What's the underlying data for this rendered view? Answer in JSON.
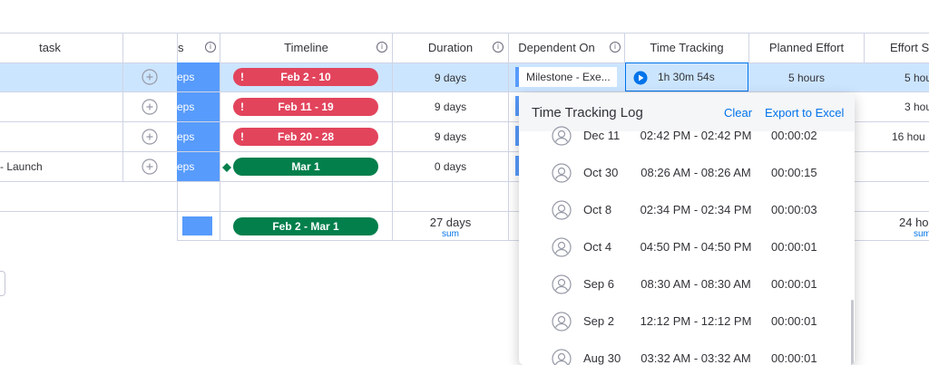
{
  "columns": {
    "task": "task",
    "owners_fragment": "s",
    "timeline": "Timeline",
    "duration": "Duration",
    "dependent_on": "Dependent On",
    "time_tracking": "Time Tracking",
    "planned_effort": "Planned Effort",
    "effort_spent": "Effort S"
  },
  "rows": [
    {
      "task": "",
      "status": "eps",
      "timeline": "Feb 2 - 10",
      "timeline_color": "#e2445c",
      "duration": "9 days",
      "dependent_on": "Milestone - Exe...",
      "time_tracking": "1h 30m 54s",
      "planned_effort": "5 hours",
      "effort_spent": "5 hou"
    },
    {
      "task": "",
      "status": "eps",
      "timeline": "Feb 11 - 19",
      "timeline_color": "#e2445c",
      "duration": "9 days",
      "planned_effort": "",
      "effort_spent": "3 hou"
    },
    {
      "task": "",
      "status": "eps",
      "timeline": "Feb 20 - 28",
      "timeline_color": "#e2445c",
      "duration": "9 days",
      "planned_effort": "",
      "effort_spent": "16 hou"
    },
    {
      "task": "- Launch",
      "status": "eps",
      "timeline": "Mar 1",
      "timeline_color": "#037f4c",
      "duration": "0 days",
      "planned_effort": "",
      "effort_spent": ""
    }
  ],
  "summary": {
    "timeline": "Feb 2 - Mar 1",
    "duration": "27 days",
    "duration_sub": "sum",
    "effort_spent": "24 hou",
    "effort_sub": "sum"
  },
  "popup": {
    "title": "Time Tracking Log",
    "clear": "Clear",
    "export": "Export to Excel",
    "entries": [
      {
        "date": "Dec 11",
        "range": "02:42 PM - 02:42 PM",
        "duration": "00:00:02"
      },
      {
        "date": "Oct 30",
        "range": "08:26 AM - 08:26 AM",
        "duration": "00:00:15"
      },
      {
        "date": "Oct 8",
        "range": "02:34 PM - 02:34 PM",
        "duration": "00:00:03"
      },
      {
        "date": "Oct 4",
        "range": "04:50 PM - 04:50 PM",
        "duration": "00:00:01"
      },
      {
        "date": "Sep 6",
        "range": "08:30 AM - 08:30 AM",
        "duration": "00:00:01"
      },
      {
        "date": "Sep 2",
        "range": "12:12 PM - 12:12 PM",
        "duration": "00:00:01"
      },
      {
        "date": "Aug 30",
        "range": "03:32 AM - 03:32 AM",
        "duration": "00:00:01"
      }
    ]
  },
  "colors": {
    "accent": "#0073ea",
    "selected_row": "#cce5ff",
    "status_blue": "#579bfc",
    "stuck_red": "#e2445c",
    "done_green": "#037f4c"
  },
  "icons": {
    "add_person": "add-person-icon",
    "info": "info-icon",
    "play": "play-icon",
    "avatar": "avatar-icon",
    "milestone": "milestone-diamond-icon"
  }
}
